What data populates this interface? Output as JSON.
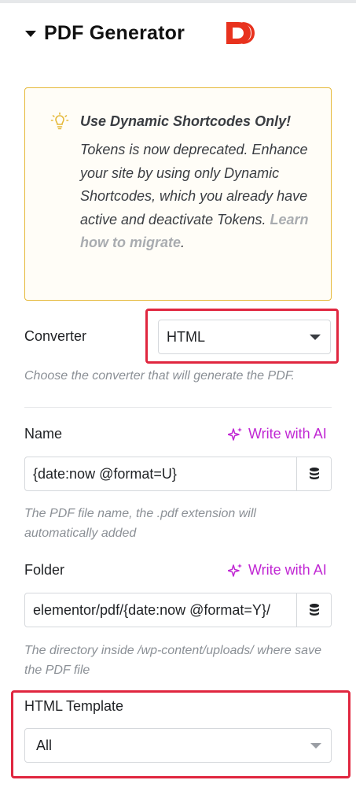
{
  "section": {
    "title": "PDF Generator",
    "logo_letter": "D"
  },
  "notice": {
    "title": "Use Dynamic Shortcodes Only!",
    "body": "Tokens is now deprecated. Enhance your site by using only Dynamic Shortcodes, which you already have active and deactivate Tokens. ",
    "link_text": "Learn how to migrate",
    "end_punct": ".",
    "border_color": "#e5b93a"
  },
  "converter": {
    "label": "Converter",
    "value": "HTML",
    "help": "Choose the converter that will generate the PDF."
  },
  "name": {
    "label": "Name",
    "ai_label": "Write with AI",
    "value": "{date:now @format=U}",
    "help": "The PDF file name, the .pdf extension will automatically added"
  },
  "folder": {
    "label": "Folder",
    "ai_label": "Write with AI",
    "value": "elementor/pdf/{date:now @format=Y}/",
    "help": "The directory inside /wp-content/uploads/ where save the PDF file"
  },
  "html_template": {
    "label": "HTML Template",
    "value": "All"
  },
  "colors": {
    "accent_ai": "#c026d3",
    "highlight": "#e0263f",
    "logo": "#e8321e"
  },
  "icons": {
    "collapse": "caret-down-icon",
    "notice": "lightbulb-icon",
    "ai": "sparkles-icon",
    "dynamic": "database-icon",
    "dropdown": "chevron-down-icon"
  }
}
